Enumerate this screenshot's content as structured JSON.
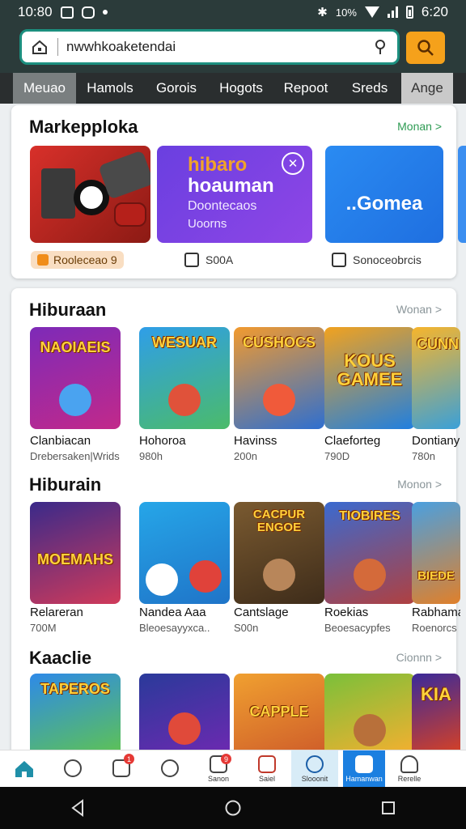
{
  "status_bar": {
    "time": "10:80",
    "right_text": "10%",
    "clock": "6:20"
  },
  "browser": {
    "url": "nwwhkoaketendai",
    "tabs": [
      "Meuao",
      "Hamols",
      "Gorois",
      "Hogots",
      "Repoot",
      "Sreds",
      "Ange"
    ]
  },
  "marketplace": {
    "title": "Markepploka",
    "more": "Monan >",
    "tiles": [
      {
        "text": "",
        "caption": "Rooleceao 9"
      },
      {
        "line1": "hibaro",
        "line2": "hoauman",
        "line3": "Doontecaos",
        "line4": "Uoorns",
        "caption": "S00A"
      },
      {
        "text": "..Gomea",
        "caption": "Sonoceobrcis"
      }
    ]
  },
  "sections": [
    {
      "title": "Hiburaan",
      "more": "Wonan >",
      "games": [
        {
          "art": "NAOIAEIS",
          "name": "Clanbiacan",
          "sub": "Drebersaken|Wrids"
        },
        {
          "art": "WESUAR",
          "name": "Hohoroa",
          "sub": "980h"
        },
        {
          "art": "CUSHOCS",
          "name": "Havinss",
          "sub": "200n"
        },
        {
          "art": "KOUS GAMEE",
          "name": "Claeforteg",
          "sub": "790D"
        },
        {
          "art": "CUNN",
          "name": "Dontiany",
          "sub": "780n"
        }
      ]
    },
    {
      "title": "Hiburain",
      "more": "Monon >",
      "games": [
        {
          "art": "MOEMAHS",
          "name": "Relareran",
          "sub": "700M"
        },
        {
          "art": "",
          "name": "Nandea Aaa",
          "sub": "Bleoesayyxca.."
        },
        {
          "art": "CACPUR ENGOE",
          "name": "Cantslage",
          "sub": "S00n"
        },
        {
          "art": "TIOBIRES",
          "name": "Roekias",
          "sub": "Beoesacypfes"
        },
        {
          "art": "BIEDE",
          "name": "Rabhama",
          "sub": "Roenorcs"
        }
      ]
    },
    {
      "title": "Kaaclie",
      "more": "Cionnn >",
      "games": [
        {
          "art": "TAPEROS"
        },
        {
          "art": ""
        },
        {
          "art": "CAPPLE"
        },
        {
          "art": ""
        },
        {
          "art": "KIA"
        }
      ]
    }
  ],
  "app_nav": {
    "items": [
      {
        "icon": "home-icon",
        "label": ""
      },
      {
        "icon": "chat-icon",
        "label": ""
      },
      {
        "icon": "store-icon",
        "label": "",
        "badge": "1"
      },
      {
        "icon": "cookie-icon",
        "label": ""
      },
      {
        "icon": "gallery-icon",
        "label": "Sanon",
        "badge": "9"
      },
      {
        "icon": "book-icon",
        "label": "Saiel"
      },
      {
        "icon": "globe-icon",
        "label": "Slooonit"
      },
      {
        "icon": "library-icon",
        "label": "Hamanwan"
      },
      {
        "icon": "profile-icon",
        "label": "Rerelle"
      }
    ]
  },
  "colors": {
    "accent": "#f5a11b",
    "url_border": "#1c8f7f",
    "status_bar": "#2b3b3a",
    "selected_nav": "#1b7fe0"
  }
}
